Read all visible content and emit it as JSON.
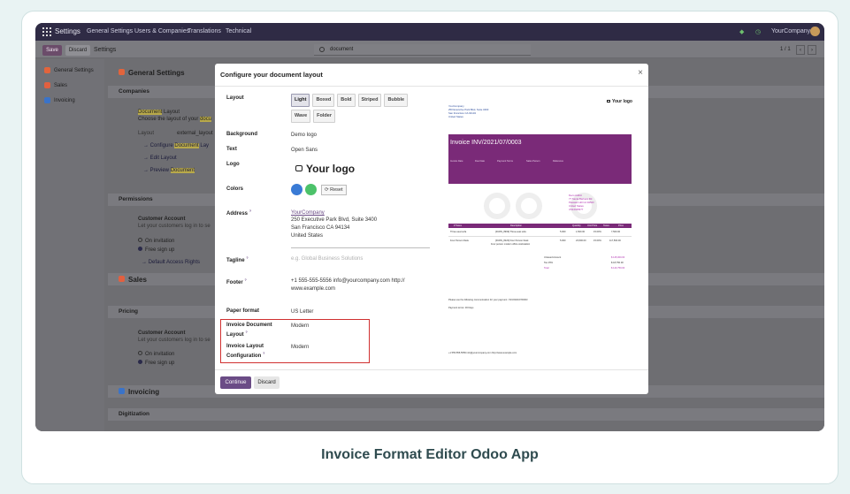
{
  "navbar": {
    "brand": "Settings",
    "menus": [
      "General Settings",
      "Users & Companies",
      "Translations",
      "Technical"
    ],
    "company": "YourCompany"
  },
  "control_panel": {
    "save_label": "Save",
    "discard_label": "Discard",
    "title": "Settings",
    "search_value": "document",
    "pager": "1 / 1"
  },
  "sidebar": {
    "items": [
      {
        "label": "General Settings",
        "color": "#e2643c"
      },
      {
        "label": "Sales",
        "color": "#e26040"
      },
      {
        "label": "Invoicing",
        "color": "#3a73c9"
      }
    ]
  },
  "settings": {
    "general_title": "General Settings",
    "companies": "Companies",
    "doc_layout_hl": "Document",
    "doc_layout_rest": " Layout",
    "doc_layout_desc": "Choose the layout of your",
    "doc_layout_desc_hl": "docu",
    "layout_label": "Layout",
    "layout_value": "external_layout",
    "configure_pre": "→ Configure ",
    "configure_hl": "Document",
    "configure_post": " Lay",
    "edit_layout": "→ Edit Layout",
    "preview_pre": "→ Preview ",
    "preview_hl": "Document",
    "permissions": "Permissions",
    "customer_account": "Customer Account",
    "customer_desc": "Let your customers log in to se",
    "on_invitation": "On invitation",
    "free_signup": "Free sign up",
    "default_access": "→ Default Access Rights",
    "sales_title": "Sales",
    "pricing": "Pricing",
    "customer_account2": "Customer Account",
    "customer_desc2": "Let your customers log in to se",
    "on_invitation2": "On invitation",
    "free_signup2": "Free sign up",
    "invoicing_title": "Invoicing",
    "digitization": "Digitization"
  },
  "modal": {
    "title": "Configure your document layout",
    "close": "×",
    "layout_label": "Layout",
    "layout_options": [
      "Light",
      "Boxed",
      "Bold",
      "Striped",
      "Bubble",
      "Wave",
      "Folder"
    ],
    "layout_selected": "Light",
    "background_label": "Background",
    "background_value": "Demo logo",
    "text_label": "Text",
    "text_value": "Open Sans",
    "logo_label": "Logo",
    "logo_value": "Your logo",
    "colors_label": "Colors",
    "color_primary": "#3a7bd5",
    "color_secondary": "#4cc26a",
    "reset_label": "Reset",
    "address_label": "Address",
    "address_company": "YourCompany",
    "address_line1": "250 Executive Park Blvd, Suite 3400",
    "address_line2": "San Francisco CA 94134",
    "address_line3": "United States",
    "tagline_label": "Tagline",
    "tagline_placeholder": "e.g. Global Business Solutions",
    "footer_label": "Footer",
    "footer_line1": "+1 555-555-5556 info@yourcompany.com http://",
    "footer_line2": "www.example.com",
    "paper_label": "Paper format",
    "paper_value": "US Letter",
    "inv_doc_layout_label1": "Invoice Document",
    "inv_doc_layout_label2": "Layout",
    "inv_doc_layout_value": "Modern",
    "inv_layout_cfg_label1": "Invoice Layout",
    "inv_layout_cfg_label2": "Configuration",
    "inv_layout_cfg_value": "Modern",
    "continue_label": "Continue",
    "discard_label": "Discard"
  },
  "preview": {
    "company_lines": [
      "YourCompany",
      "250 Executive Park Blvd, Suite 3400",
      "San Francisco CA 94134",
      "United States"
    ],
    "logo": "Your logo",
    "invoice_title": "Invoice INV/2021/07/0003",
    "header_fields": [
      "Invoice Date",
      "Due Date",
      "Payment Terms",
      "Sales Person",
      "Reference"
    ],
    "partner_lines": [
      "Deco Addict",
      "77 Santa Barbara Rd",
      "Pleasant Hill CA 94523",
      "United States",
      "US12345677"
    ],
    "columns": [
      "# Taxes",
      "Description",
      "Quantity",
      "Unit Price",
      "Taxes",
      "Price"
    ],
    "rows": [
      [
        "Three-seat sofa",
        "[FURN_8999] Three-seat sofa",
        "5.000",
        "1,500.00",
        "15.00%",
        "7,500.00"
      ],
      [
        "Four Person Desk",
        "[FURN_8220] Four Person Desk",
        "5.000",
        "23,500.00",
        "15.00%",
        "117,500.00"
      ]
    ],
    "row2_extra": "Four person modern office workstation",
    "totals": [
      [
        "Untaxed Amount",
        "$ 125,000.00"
      ],
      [
        "Tax 15%",
        "$ 18,750.00"
      ],
      [
        "Total",
        "$ 143,750.00"
      ]
    ],
    "payment_note": "Please use the following communication for your payment : INV/2021/07/0003",
    "payment_terms": "Payment terms: 30 Days",
    "footer": "+1 555-555-5556 info@yourcompany.com http://www.example.com"
  },
  "caption": "Invoice Format Editor Odoo App"
}
